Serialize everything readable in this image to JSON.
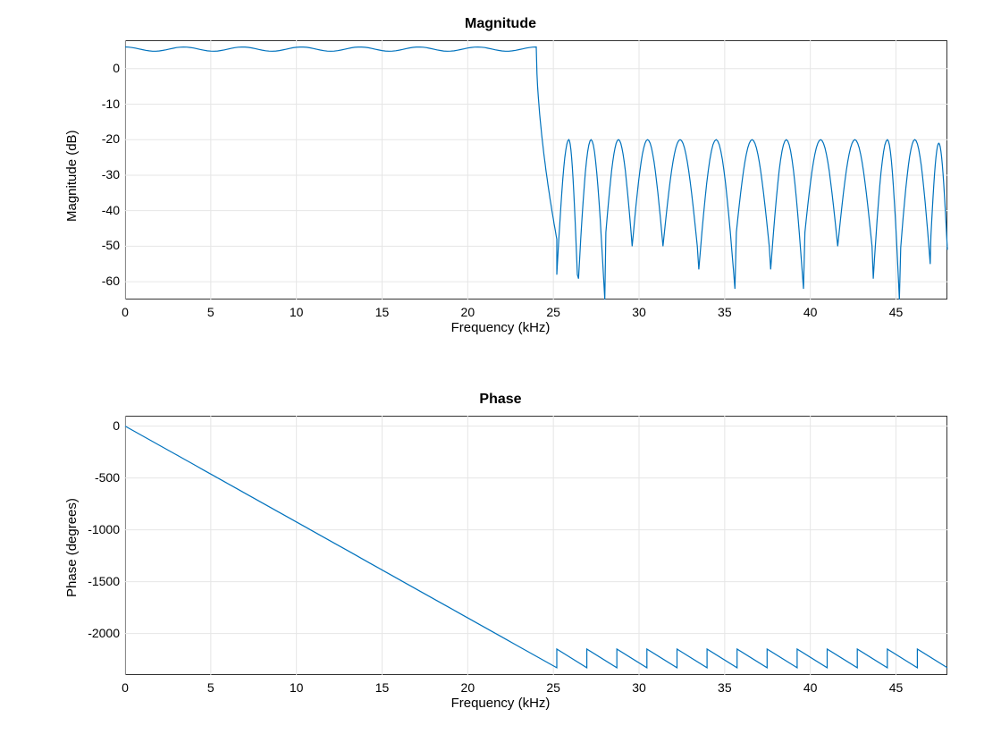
{
  "chart_data": [
    {
      "type": "line",
      "title": "Magnitude",
      "xlabel": "Frequency (kHz)",
      "ylabel": "Magnitude (dB)",
      "xlim": [
        0,
        48
      ],
      "ylim": [
        -65,
        8
      ],
      "xticks": [
        0,
        5,
        10,
        15,
        20,
        25,
        30,
        35,
        40,
        45
      ],
      "yticks": [
        -60,
        -50,
        -40,
        -30,
        -20,
        -10,
        0
      ],
      "color": "#0072BD",
      "passband": {
        "start": 0,
        "end": 24,
        "level": 5.5,
        "ripple": 0.6,
        "cycles": 7
      },
      "transition": {
        "start": 24,
        "end": 25.2,
        "from": 5.5,
        "to": -48
      },
      "stopband_lobes": [
        {
          "start": 25.2,
          "peak": 25.9,
          "end": 26.4,
          "top": -20,
          "dip": -58
        },
        {
          "start": 26.4,
          "peak": 27.2,
          "end": 28.0,
          "top": -20,
          "dip": -65
        },
        {
          "start": 28.0,
          "peak": 28.8,
          "end": 29.6,
          "top": -20,
          "dip": -50
        },
        {
          "start": 29.6,
          "peak": 30.5,
          "end": 31.4,
          "top": -20,
          "dip": -50
        },
        {
          "start": 31.4,
          "peak": 32.4,
          "end": 33.4,
          "top": -20,
          "dip": -50
        },
        {
          "start": 33.4,
          "peak": 34.5,
          "end": 35.6,
          "top": -20,
          "dip": -62
        },
        {
          "start": 35.6,
          "peak": 36.6,
          "end": 37.6,
          "top": -20,
          "dip": -50
        },
        {
          "start": 37.6,
          "peak": 38.6,
          "end": 39.6,
          "top": -20,
          "dip": -62
        },
        {
          "start": 39.6,
          "peak": 40.6,
          "end": 41.6,
          "top": -20,
          "dip": -50
        },
        {
          "start": 41.6,
          "peak": 42.6,
          "end": 43.6,
          "top": -20,
          "dip": -50
        },
        {
          "start": 43.6,
          "peak": 44.5,
          "end": 45.2,
          "top": -20,
          "dip": -65
        },
        {
          "start": 45.2,
          "peak": 46.1,
          "end": 47.0,
          "top": -20,
          "dip": -55
        },
        {
          "start": 47.0,
          "peak": 47.5,
          "end": 48.0,
          "top": -21,
          "dip": -51
        }
      ]
    },
    {
      "type": "line",
      "title": "Phase",
      "xlabel": "Frequency (kHz)",
      "ylabel": "Phase (degrees)",
      "xlim": [
        0,
        48
      ],
      "ylim": [
        -2400,
        100
      ],
      "xticks": [
        0,
        5,
        10,
        15,
        20,
        25,
        30,
        35,
        40,
        45
      ],
      "yticks": [
        -2000,
        -1500,
        -1000,
        -500,
        0
      ],
      "color": "#0072BD",
      "linear": {
        "x0": 0,
        "y0": 0,
        "x1": 25.2,
        "y1": -2330
      },
      "sawtooth_start": 25.2,
      "sawtooth_end": 48,
      "sawtooth_low": -2330,
      "sawtooth_high": -2150,
      "sawtooth_teeth": 13
    }
  ]
}
